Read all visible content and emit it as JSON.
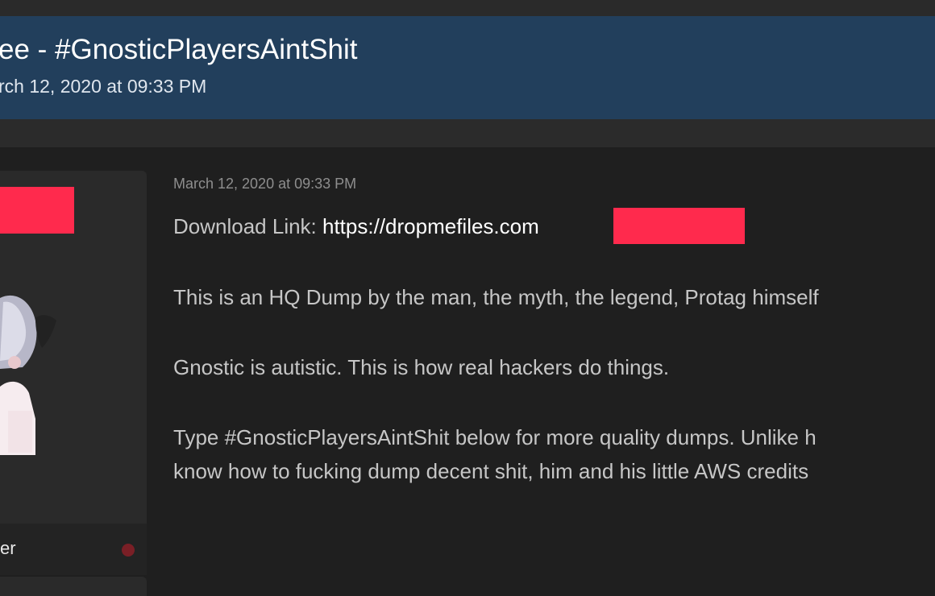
{
  "thread": {
    "title": "ee - #GnosticPlayersAintShit",
    "date": "rch 12, 2020 at 09:33 PM"
  },
  "user": {
    "role_label": "er",
    "status_color": "#7a1f26"
  },
  "post": {
    "date": "March 12, 2020 at 09:33 PM",
    "download_label": "Download Link: ",
    "download_link": "https://dropmefiles.com",
    "paragraphs": [
      "This is an HQ Dump by the man, the myth, the legend, Protag himself",
      "Gnostic is autistic. This is how real hackers do things.",
      "Type #GnosticPlayersAintShit below for more quality dumps. Unlike h",
      "know how to fucking dump decent shit, him and his little AWS credits"
    ]
  },
  "colors": {
    "header_bg": "#223f5c",
    "redaction": "#ff2a4d",
    "page_bg": "#1f1f1f"
  }
}
